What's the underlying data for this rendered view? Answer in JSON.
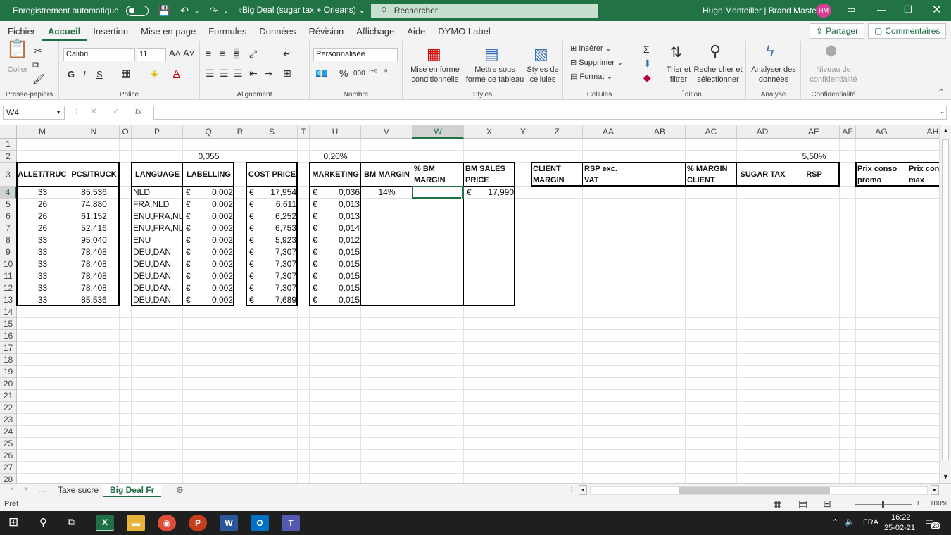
{
  "titlebar": {
    "autosave_label": "Enregistrement automatique",
    "doc_title": "Big Deal (sugar tax + Orleans)",
    "search_placeholder": "Rechercher",
    "user": "Hugo Monteiller | Brand Masters",
    "avatar": "HM"
  },
  "menu": {
    "items": [
      "Fichier",
      "Accueil",
      "Insertion",
      "Mise en page",
      "Formules",
      "Données",
      "Révision",
      "Affichage",
      "Aide",
      "DYMO Label"
    ],
    "active": "Accueil",
    "share": "Partager",
    "comments": "Commentaires"
  },
  "ribbon": {
    "clipboard": {
      "paste": "Coller",
      "label": "Presse-papiers"
    },
    "font": {
      "name": "Calibri",
      "size": "11",
      "bold": "G",
      "italic": "I",
      "underline": "S",
      "label": "Police"
    },
    "alignment": {
      "label": "Alignement"
    },
    "number": {
      "format": "Personnalisée",
      "label": "Nombre",
      "percent": "%",
      "thousands": "000"
    },
    "styles": {
      "cond": "Mise en forme conditionnelle",
      "table": "Mettre sous forme de tableau",
      "cell": "Styles de cellules",
      "label": "Styles"
    },
    "cells": {
      "insert": "Insérer",
      "delete": "Supprimer",
      "format": "Format",
      "label": "Cellules"
    },
    "editing": {
      "sort": "Trier et filtrer",
      "find": "Rechercher et sélectionner",
      "label": "Édition"
    },
    "analysis": {
      "analyze": "Analyser des données",
      "label": "Analyse"
    },
    "sensitivity": {
      "level": "Niveau de confidentialité",
      "label": "Confidentialité"
    }
  },
  "formula_bar": {
    "name_box": "W4",
    "fx": "fx",
    "value": ""
  },
  "sheet": {
    "columns": [
      "M",
      "N",
      "O",
      "P",
      "Q",
      "R",
      "S",
      "T",
      "U",
      "V",
      "W",
      "X",
      "Y",
      "Z",
      "AA",
      "AB",
      "AC",
      "AD",
      "AE",
      "AF",
      "AG",
      "AH"
    ],
    "selected_column": "W",
    "rows": [
      "1",
      "2",
      "3",
      "4",
      "5",
      "6",
      "7",
      "8",
      "9",
      "10",
      "11",
      "12",
      "13",
      "14",
      "15",
      "16",
      "17",
      "18",
      "19",
      "20",
      "21",
      "22",
      "23",
      "24",
      "25",
      "26",
      "27",
      "28"
    ],
    "selected_row": "4",
    "row2": {
      "Q": "0,055",
      "U": "0,20%",
      "AE": "5,50%"
    },
    "headers": {
      "M": "PALLET/TRUCK",
      "N": "PCS/TRUCK",
      "P": "LANGUAGE",
      "Q": "LABELLING",
      "S": "COST PRICE",
      "U": "MARKETING",
      "V": "BM MARGIN",
      "W": "% BM MARGIN",
      "X": "BM SALES PRICE",
      "Z": "CLIENT MARGIN",
      "AA": "RSP exc. VAT",
      "AC": "% MARGIN CLIENT",
      "AD": "SUGAR TAX",
      "AE": "RSP",
      "AG": "Prix conso promo",
      "AH": "Prix cons max"
    },
    "currency": "€",
    "data": [
      {
        "M": "33",
        "N": "85.536",
        "P": "NLD",
        "Q": "0,002",
        "S": "17,954",
        "U": "0,036",
        "V": "14%",
        "X": "17,990"
      },
      {
        "M": "26",
        "N": "74.880",
        "P": "FRA,NLD",
        "Q": "0,002",
        "S": "6,611",
        "U": "0,013"
      },
      {
        "M": "26",
        "N": "61.152",
        "P": "ENU,FRA,NLD",
        "Q": "0,002",
        "S": "6,252",
        "U": "0,013"
      },
      {
        "M": "26",
        "N": "52.416",
        "P": "ENU,FRA,NLD",
        "Q": "0,002",
        "S": "6,753",
        "U": "0,014"
      },
      {
        "M": "33",
        "N": "95.040",
        "P": "ENU",
        "Q": "0,002",
        "S": "5,923",
        "U": "0,012"
      },
      {
        "M": "33",
        "N": "78.408",
        "P": "DEU,DAN",
        "Q": "0,002",
        "S": "7,307",
        "U": "0,015"
      },
      {
        "M": "33",
        "N": "78.408",
        "P": "DEU,DAN",
        "Q": "0,002",
        "S": "7,307",
        "U": "0,015"
      },
      {
        "M": "33",
        "N": "78.408",
        "P": "DEU,DAN",
        "Q": "0,002",
        "S": "7,307",
        "U": "0,015"
      },
      {
        "M": "33",
        "N": "78.408",
        "P": "DEU,DAN",
        "Q": "0,002",
        "S": "7,307",
        "U": "0,015"
      },
      {
        "M": "33",
        "N": "85.536",
        "P": "DEU,DAN",
        "Q": "0,002",
        "S": "7,689",
        "U": "0,015"
      }
    ]
  },
  "tabs": {
    "items": [
      "Taxe sucre",
      "Big Deal Fr"
    ],
    "active": "Big Deal Fr"
  },
  "status": {
    "ready": "Prêt",
    "zoom": "100%"
  },
  "taskbar": {
    "lang": "FRA",
    "time": "16:22",
    "date": "25-02-21",
    "notif": "20"
  }
}
